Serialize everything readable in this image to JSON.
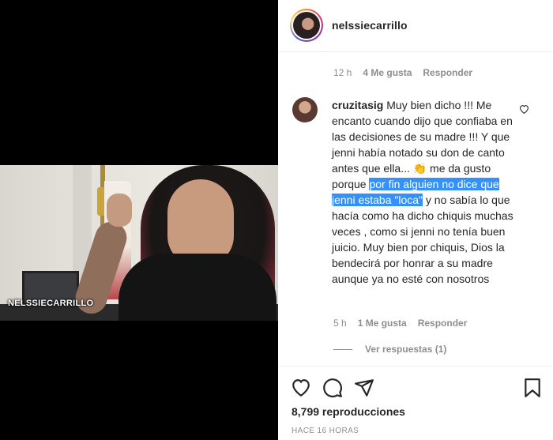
{
  "video": {
    "watermark": "NELSSIECARRILLO"
  },
  "post": {
    "username": "nelssiecarrillo"
  },
  "top_comment_meta": {
    "time": "12 h",
    "likes": "4 Me gusta",
    "reply": "Responder"
  },
  "comment": {
    "username": "cruzitasig",
    "text_before": " Muy bien dicho !!! Me encanto cuando dijo que confiaba en las decisiones de su madre !!! Y que jenni había notado su don de canto antes que ella... 👏 me da gusto porque ",
    "text_highlight": "por fin alguien no dice que jenni estaba \"loca\"",
    "text_after": " y no sabía lo que hacía como ha dicho chiquis muchas veces , como si jenni no tenía buen juicio. Muy bien por chiquis, Dios la bendecirá por honrar a su madre aunque ya no esté con nosotros",
    "time": "5 h",
    "likes": "1 Me gusta",
    "reply": "Responder",
    "view_replies": "Ver respuestas (1)"
  },
  "footer": {
    "views": "8,799 reproducciones",
    "posted": "Hace 16 horas"
  },
  "colors": {
    "highlight": "#3390ff",
    "muted": "#8e8e8e",
    "text": "#262626"
  }
}
